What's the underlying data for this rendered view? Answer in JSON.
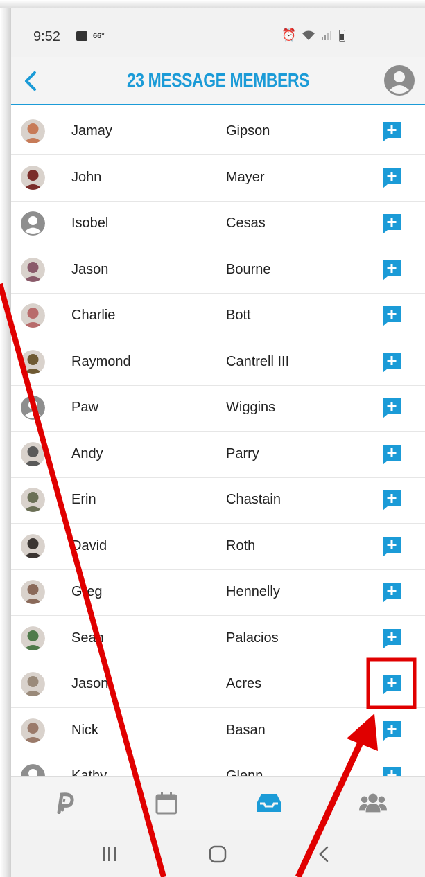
{
  "status_bar": {
    "time": "9:52",
    "temperature": "66°"
  },
  "header": {
    "title": "23 MESSAGE MEMBERS",
    "accent_color": "#1b9bd7"
  },
  "members": [
    {
      "first": "Jamay",
      "last": "Gipson",
      "avatar": "photo",
      "color": "#c77b58"
    },
    {
      "first": "John",
      "last": "Mayer",
      "avatar": "photo",
      "color": "#7a2d2a"
    },
    {
      "first": "Isobel",
      "last": "Cesas",
      "avatar": "default",
      "color": "#8e8e8e"
    },
    {
      "first": "Jason",
      "last": "Bourne",
      "avatar": "photo",
      "color": "#8a5a6a"
    },
    {
      "first": "Charlie",
      "last": "Bott",
      "avatar": "photo",
      "color": "#b86b6b"
    },
    {
      "first": "Raymond",
      "last": "Cantrell III",
      "avatar": "photo",
      "color": "#6f5a33"
    },
    {
      "first": "Paw",
      "last": "Wiggins",
      "avatar": "default",
      "color": "#8e8e8e"
    },
    {
      "first": "Andy",
      "last": "Parry",
      "avatar": "photo",
      "color": "#5a5a5a"
    },
    {
      "first": "Erin",
      "last": "Chastain",
      "avatar": "photo",
      "color": "#6b7056"
    },
    {
      "first": "David",
      "last": "Roth",
      "avatar": "photo",
      "color": "#3b3532"
    },
    {
      "first": "Greg",
      "last": "Hennelly",
      "avatar": "photo",
      "color": "#8a6a5a"
    },
    {
      "first": "Sean",
      "last": "Palacios",
      "avatar": "photo",
      "color": "#4f7a4a"
    },
    {
      "first": "Jason",
      "last": "Acres",
      "avatar": "photo",
      "color": "#9a8a7a"
    },
    {
      "first": "Nick",
      "last": "Basan",
      "avatar": "photo",
      "color": "#9a7a6a"
    },
    {
      "first": "Kathy",
      "last": "Glenn",
      "avatar": "default",
      "color": "#8e8e8e"
    }
  ],
  "bottom_nav": [
    {
      "icon": "p-logo-icon",
      "active": false
    },
    {
      "icon": "calendar-icon",
      "active": false
    },
    {
      "icon": "inbox-icon",
      "active": true
    },
    {
      "icon": "users-icon",
      "active": false
    }
  ],
  "system_nav": [
    "recents-icon",
    "home-icon",
    "back-icon"
  ],
  "annotations": {
    "highlight_color": "#e00000"
  }
}
